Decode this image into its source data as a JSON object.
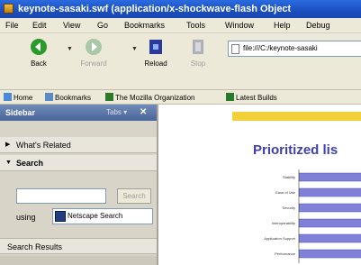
{
  "window": {
    "title": "keynote-sasaki.swf (application/x-shockwave-flash Object"
  },
  "menubar": {
    "items": [
      {
        "label": "File",
        "name": "menu-file"
      },
      {
        "label": "Edit",
        "name": "menu-edit"
      },
      {
        "label": "View",
        "name": "menu-view"
      },
      {
        "label": "Go",
        "name": "menu-go"
      },
      {
        "label": "Bookmarks",
        "name": "menu-bookmarks"
      },
      {
        "label": "Tools",
        "name": "menu-tools"
      },
      {
        "label": "Window",
        "name": "menu-window"
      },
      {
        "label": "Help",
        "name": "menu-help"
      },
      {
        "label": "Debug",
        "name": "menu-debug"
      }
    ]
  },
  "navbar": {
    "back_label": "Back",
    "forward_label": "Forward",
    "reload_label": "Reload",
    "stop_label": "Stop",
    "url": "file:///C:/keynote-sasaki"
  },
  "bookmarks_bar": {
    "items": [
      "Home",
      "Bookmarks",
      "The Mozilla Organization",
      "Latest Builds"
    ]
  },
  "sidebar": {
    "title": "Sidebar",
    "tabs_label": "Tabs",
    "whats_related": "What's Related",
    "search": "Search",
    "search_input_value": "",
    "search_button": "Search",
    "using_label": "using",
    "engine": "Netscape Search",
    "results_label": "Search Results"
  },
  "content": {
    "heading": "Prioritized lis"
  },
  "chart_data": {
    "type": "bar",
    "title": "Prioritized lis",
    "categories": [
      "Stability",
      "Ease of Use",
      "Security",
      "Interoperability",
      "Application Support",
      "Performance"
    ],
    "values": [
      1,
      1,
      1,
      1,
      1,
      1
    ],
    "bar_color": "#8080d8"
  },
  "colors": {
    "titlebar": "#1a4fbf",
    "chrome": "#ece9d8",
    "heading": "#4040b0",
    "banner": "#f2d03a"
  }
}
